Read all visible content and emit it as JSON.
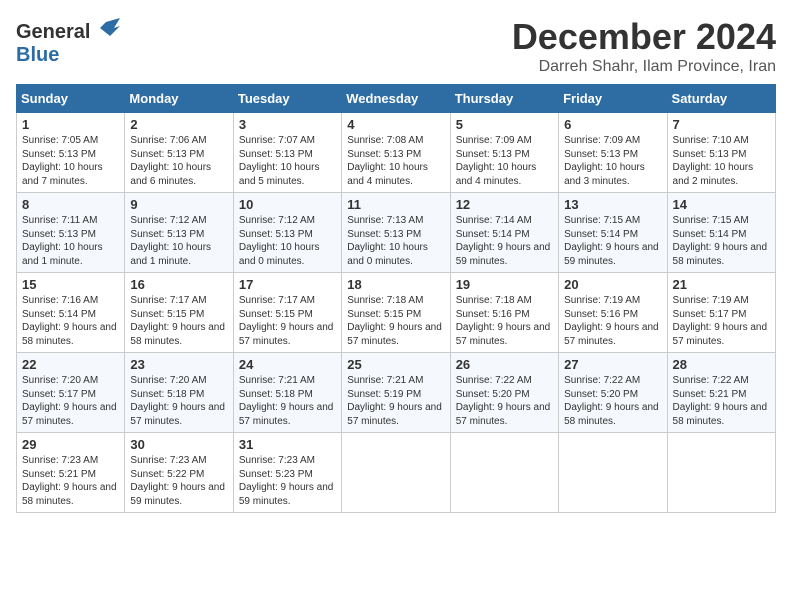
{
  "header": {
    "logo_general": "General",
    "logo_blue": "Blue",
    "month_title": "December 2024",
    "subtitle": "Darreh Shahr, Ilam Province, Iran"
  },
  "days_of_week": [
    "Sunday",
    "Monday",
    "Tuesday",
    "Wednesday",
    "Thursday",
    "Friday",
    "Saturday"
  ],
  "weeks": [
    [
      {
        "day": "1",
        "sunrise": "Sunrise: 7:05 AM",
        "sunset": "Sunset: 5:13 PM",
        "daylight": "Daylight: 10 hours and 7 minutes."
      },
      {
        "day": "2",
        "sunrise": "Sunrise: 7:06 AM",
        "sunset": "Sunset: 5:13 PM",
        "daylight": "Daylight: 10 hours and 6 minutes."
      },
      {
        "day": "3",
        "sunrise": "Sunrise: 7:07 AM",
        "sunset": "Sunset: 5:13 PM",
        "daylight": "Daylight: 10 hours and 5 minutes."
      },
      {
        "day": "4",
        "sunrise": "Sunrise: 7:08 AM",
        "sunset": "Sunset: 5:13 PM",
        "daylight": "Daylight: 10 hours and 4 minutes."
      },
      {
        "day": "5",
        "sunrise": "Sunrise: 7:09 AM",
        "sunset": "Sunset: 5:13 PM",
        "daylight": "Daylight: 10 hours and 4 minutes."
      },
      {
        "day": "6",
        "sunrise": "Sunrise: 7:09 AM",
        "sunset": "Sunset: 5:13 PM",
        "daylight": "Daylight: 10 hours and 3 minutes."
      },
      {
        "day": "7",
        "sunrise": "Sunrise: 7:10 AM",
        "sunset": "Sunset: 5:13 PM",
        "daylight": "Daylight: 10 hours and 2 minutes."
      }
    ],
    [
      {
        "day": "8",
        "sunrise": "Sunrise: 7:11 AM",
        "sunset": "Sunset: 5:13 PM",
        "daylight": "Daylight: 10 hours and 1 minute."
      },
      {
        "day": "9",
        "sunrise": "Sunrise: 7:12 AM",
        "sunset": "Sunset: 5:13 PM",
        "daylight": "Daylight: 10 hours and 1 minute."
      },
      {
        "day": "10",
        "sunrise": "Sunrise: 7:12 AM",
        "sunset": "Sunset: 5:13 PM",
        "daylight": "Daylight: 10 hours and 0 minutes."
      },
      {
        "day": "11",
        "sunrise": "Sunrise: 7:13 AM",
        "sunset": "Sunset: 5:13 PM",
        "daylight": "Daylight: 10 hours and 0 minutes."
      },
      {
        "day": "12",
        "sunrise": "Sunrise: 7:14 AM",
        "sunset": "Sunset: 5:14 PM",
        "daylight": "Daylight: 9 hours and 59 minutes."
      },
      {
        "day": "13",
        "sunrise": "Sunrise: 7:15 AM",
        "sunset": "Sunset: 5:14 PM",
        "daylight": "Daylight: 9 hours and 59 minutes."
      },
      {
        "day": "14",
        "sunrise": "Sunrise: 7:15 AM",
        "sunset": "Sunset: 5:14 PM",
        "daylight": "Daylight: 9 hours and 58 minutes."
      }
    ],
    [
      {
        "day": "15",
        "sunrise": "Sunrise: 7:16 AM",
        "sunset": "Sunset: 5:14 PM",
        "daylight": "Daylight: 9 hours and 58 minutes."
      },
      {
        "day": "16",
        "sunrise": "Sunrise: 7:17 AM",
        "sunset": "Sunset: 5:15 PM",
        "daylight": "Daylight: 9 hours and 58 minutes."
      },
      {
        "day": "17",
        "sunrise": "Sunrise: 7:17 AM",
        "sunset": "Sunset: 5:15 PM",
        "daylight": "Daylight: 9 hours and 57 minutes."
      },
      {
        "day": "18",
        "sunrise": "Sunrise: 7:18 AM",
        "sunset": "Sunset: 5:15 PM",
        "daylight": "Daylight: 9 hours and 57 minutes."
      },
      {
        "day": "19",
        "sunrise": "Sunrise: 7:18 AM",
        "sunset": "Sunset: 5:16 PM",
        "daylight": "Daylight: 9 hours and 57 minutes."
      },
      {
        "day": "20",
        "sunrise": "Sunrise: 7:19 AM",
        "sunset": "Sunset: 5:16 PM",
        "daylight": "Daylight: 9 hours and 57 minutes."
      },
      {
        "day": "21",
        "sunrise": "Sunrise: 7:19 AM",
        "sunset": "Sunset: 5:17 PM",
        "daylight": "Daylight: 9 hours and 57 minutes."
      }
    ],
    [
      {
        "day": "22",
        "sunrise": "Sunrise: 7:20 AM",
        "sunset": "Sunset: 5:17 PM",
        "daylight": "Daylight: 9 hours and 57 minutes."
      },
      {
        "day": "23",
        "sunrise": "Sunrise: 7:20 AM",
        "sunset": "Sunset: 5:18 PM",
        "daylight": "Daylight: 9 hours and 57 minutes."
      },
      {
        "day": "24",
        "sunrise": "Sunrise: 7:21 AM",
        "sunset": "Sunset: 5:18 PM",
        "daylight": "Daylight: 9 hours and 57 minutes."
      },
      {
        "day": "25",
        "sunrise": "Sunrise: 7:21 AM",
        "sunset": "Sunset: 5:19 PM",
        "daylight": "Daylight: 9 hours and 57 minutes."
      },
      {
        "day": "26",
        "sunrise": "Sunrise: 7:22 AM",
        "sunset": "Sunset: 5:20 PM",
        "daylight": "Daylight: 9 hours and 57 minutes."
      },
      {
        "day": "27",
        "sunrise": "Sunrise: 7:22 AM",
        "sunset": "Sunset: 5:20 PM",
        "daylight": "Daylight: 9 hours and 58 minutes."
      },
      {
        "day": "28",
        "sunrise": "Sunrise: 7:22 AM",
        "sunset": "Sunset: 5:21 PM",
        "daylight": "Daylight: 9 hours and 58 minutes."
      }
    ],
    [
      {
        "day": "29",
        "sunrise": "Sunrise: 7:23 AM",
        "sunset": "Sunset: 5:21 PM",
        "daylight": "Daylight: 9 hours and 58 minutes."
      },
      {
        "day": "30",
        "sunrise": "Sunrise: 7:23 AM",
        "sunset": "Sunset: 5:22 PM",
        "daylight": "Daylight: 9 hours and 59 minutes."
      },
      {
        "day": "31",
        "sunrise": "Sunrise: 7:23 AM",
        "sunset": "Sunset: 5:23 PM",
        "daylight": "Daylight: 9 hours and 59 minutes."
      },
      null,
      null,
      null,
      null
    ]
  ]
}
